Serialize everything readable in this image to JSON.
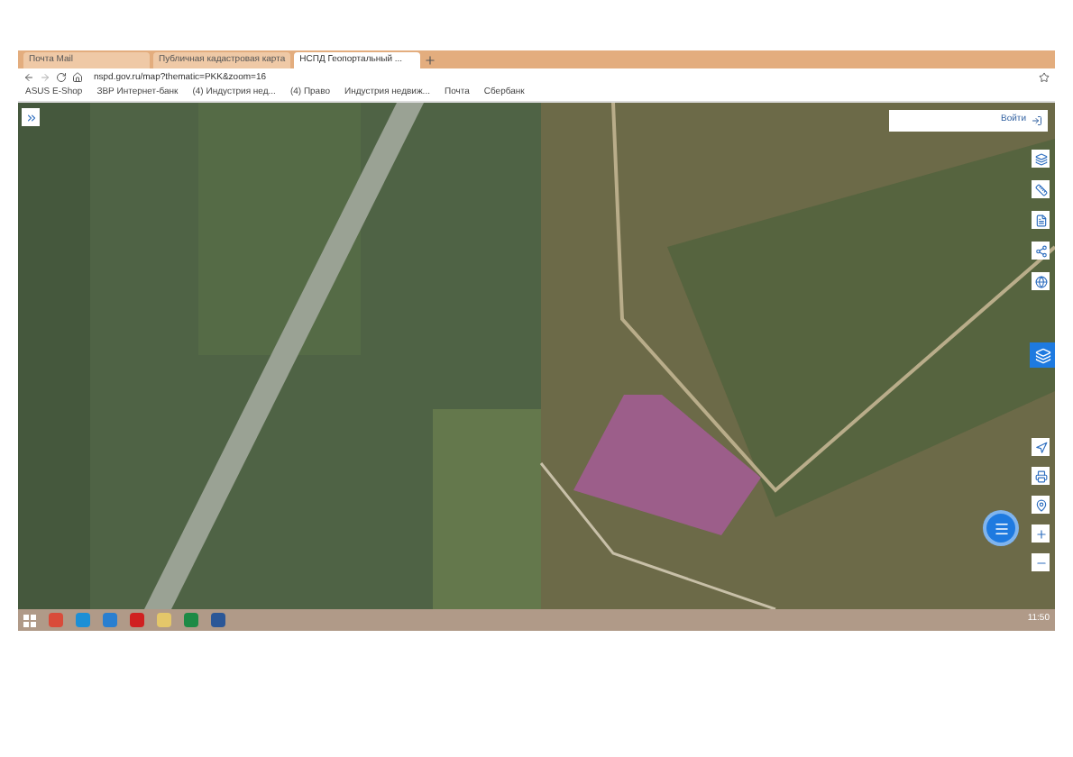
{
  "browser": {
    "tabs": [
      {
        "title": "Почта Mail",
        "selected": false
      },
      {
        "title": "Публичная кадастровая карта",
        "selected": false
      },
      {
        "title": "НСПД Геопортальный ...",
        "selected": true
      }
    ],
    "address": "nspd.gov.ru/map?thematic=PKK&zoom=16",
    "bookmarks": [
      "ASUS E-Shop",
      "ЗВР Интернет-банк",
      "(4) Индустрия нед...",
      "(4) Право",
      "Индустрия недвиж...",
      "Почта",
      "Сбербанк"
    ]
  },
  "map": {
    "login_button": "Войти"
  },
  "taskbar": {
    "time": "11:50"
  }
}
